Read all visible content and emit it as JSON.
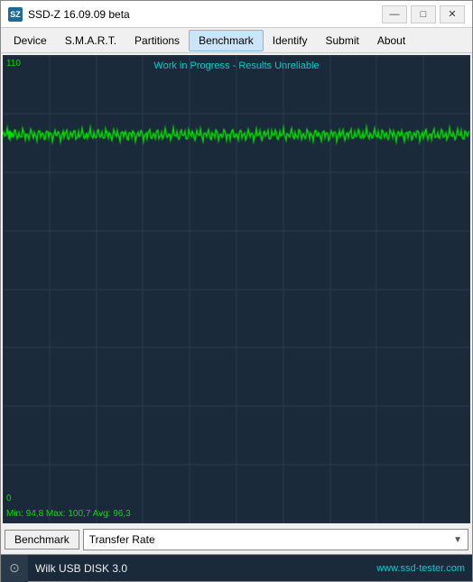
{
  "window": {
    "title": "SSD-Z 16.09.09 beta",
    "icon": "SZ"
  },
  "title_controls": {
    "minimize": "—",
    "maximize": "□",
    "close": "✕"
  },
  "menu": {
    "items": [
      "Device",
      "S.M.A.R.T.",
      "Partitions",
      "Benchmark",
      "Identify",
      "Submit",
      "About"
    ],
    "active": "Benchmark"
  },
  "chart": {
    "title": "Work in Progress - Results Unreliable",
    "y_max": "110",
    "y_min": "0",
    "stats": "Min: 94,8  Max: 100,7  Avg: 96,3"
  },
  "bottom": {
    "button_label": "Benchmark",
    "dropdown_value": "Transfer Rate"
  },
  "status": {
    "icon": "⊙",
    "text": "Wilk USB DISK 3.0",
    "brand": "www.ssd-tester.com"
  }
}
